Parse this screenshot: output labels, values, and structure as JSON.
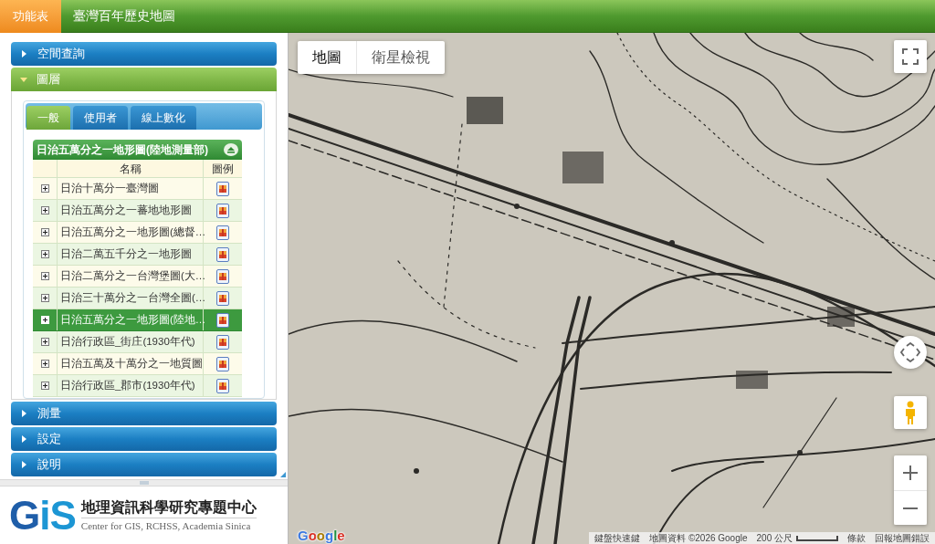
{
  "top_bar": {
    "menu_tab": "功能表",
    "title": "臺灣百年歷史地圖"
  },
  "sidebar": {
    "sections": [
      {
        "label": "空間查詢",
        "expanded": false
      },
      {
        "label": "圖層",
        "expanded": true,
        "tabs": [
          {
            "label": "一般",
            "selected": true
          },
          {
            "label": "使用者",
            "selected": false
          },
          {
            "label": "線上數化",
            "selected": false
          }
        ],
        "layer_table": {
          "title": "日治五萬分之一地形圖(陸地測量部)",
          "columns": [
            "名稱",
            "圖例"
          ],
          "rows": [
            {
              "name": "日治十萬分一臺灣圖",
              "selected": false
            },
            {
              "name": "日治五萬分之一蕃地地形圖",
              "selected": false
            },
            {
              "name": "日治五萬分之一地形圖(總督…",
              "selected": false
            },
            {
              "name": "日治二萬五千分之一地形圖",
              "selected": false
            },
            {
              "name": "日治二萬分之一台灣堡圖(大…",
              "selected": false
            },
            {
              "name": "日治三十萬分之一台灣全圖(…",
              "selected": false
            },
            {
              "name": "日治五萬分之一地形圖(陸地…",
              "selected": true
            },
            {
              "name": "日治行政區_街庄(1930年代)",
              "selected": false
            },
            {
              "name": "日治五萬及十萬分之一地質圖",
              "selected": false
            },
            {
              "name": "日治行政區_郡市(1930年代)",
              "selected": false
            }
          ]
        }
      },
      {
        "label": "測量",
        "expanded": false
      },
      {
        "label": "設定",
        "expanded": false
      },
      {
        "label": "說明",
        "expanded": false
      }
    ]
  },
  "logo": {
    "mark": "GiS",
    "name": "地理資訊科學研究專題中心",
    "subtitle": "Center for GIS, RCHSS, Academia Sinica"
  },
  "map": {
    "map_types": [
      {
        "label": "地圖",
        "selected": true
      },
      {
        "label": "衛星檢視",
        "selected": false
      }
    ],
    "google_logo": "Google",
    "keyboard_shortcuts": "鍵盤快速鍵",
    "map_data": "地圖資料 ©2026 Google",
    "scale": "200 公尺",
    "terms": "條款",
    "report": "回報地圖錯誤"
  }
}
